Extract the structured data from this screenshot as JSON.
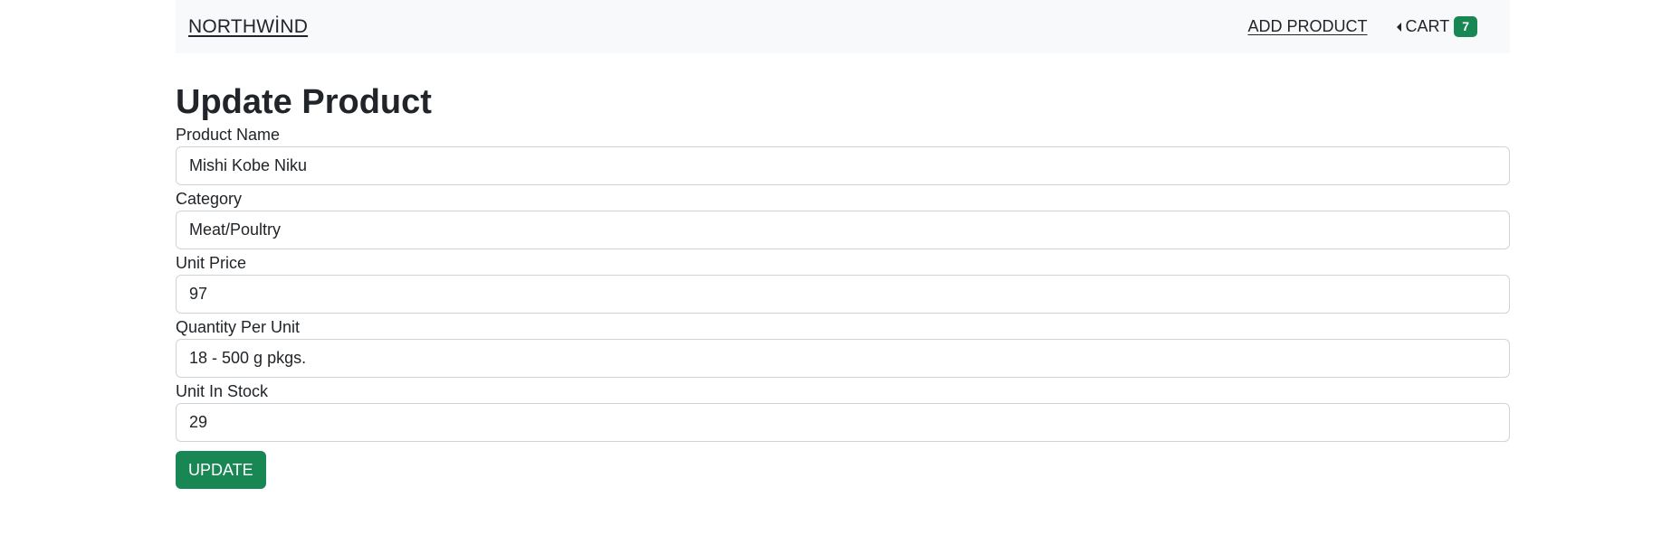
{
  "navbar": {
    "brand": "NORTHWİND",
    "add_product": "ADD PRODUCT",
    "cart_label": "CART",
    "cart_count": "7"
  },
  "page": {
    "title": "Update Product"
  },
  "form": {
    "fields": [
      {
        "label": "Product Name",
        "value": "Mishi Kobe Niku"
      },
      {
        "label": "Category",
        "value": "Meat/Poultry"
      },
      {
        "label": "Unit Price",
        "value": "97"
      },
      {
        "label": "Quantity Per Unit",
        "value": "18 - 500 g pkgs."
      },
      {
        "label": "Unit In Stock",
        "value": "29"
      }
    ],
    "submit_label": "UPDATE"
  },
  "colors": {
    "accent": "#198754",
    "navbar_bg": "#f8f9fa",
    "text": "#212529"
  }
}
